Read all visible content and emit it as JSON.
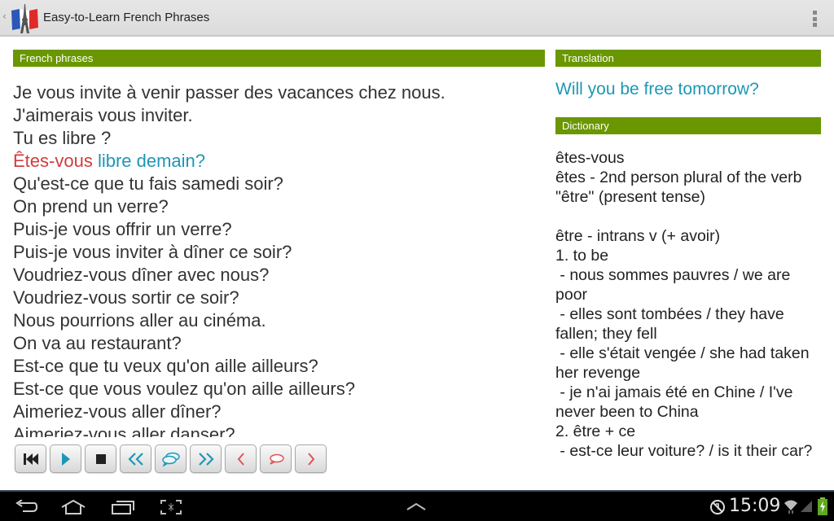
{
  "app": {
    "title": "Easy-to-Learn French Phrases",
    "icon": "eiffel-tower-flag-icon",
    "up_indicator": "‹",
    "overflow_icon": "overflow-menu-icon"
  },
  "left_panel": {
    "header": "French phrases",
    "phrases": [
      "Je vous invite à venir passer des vacances chez nous.",
      "J'aimerais vous inviter.",
      "Tu es libre ?",
      "Êtes-vous libre demain?",
      "Qu'est-ce que tu fais samedi soir?",
      "On prend un verre?",
      "Puis-je vous offrir un verre?",
      "Puis-je vous inviter à dîner ce soir?",
      "Voudriez-vous dîner avec nous?",
      "Voudriez-vous sortir ce soir?",
      "Nous pourrions aller au cinéma.",
      "On va au restaurant?",
      "Est-ce que tu veux qu'on aille ailleurs?",
      "Est-ce que vous voulez qu'on aille ailleurs?",
      "Aimeriez-vous aller dîner?",
      "Aimeriez-vous aller danser?"
    ],
    "selected": {
      "index": 3,
      "highlighted_word": "Êtes-vous",
      "rest": " libre demain?",
      "word_color": "#d23c3c",
      "rest_color": "#1d97b6"
    },
    "controls": [
      {
        "name": "skip-to-start-button",
        "icon": "skip-to-start-icon",
        "color": "#222222"
      },
      {
        "name": "play-button",
        "icon": "play-icon",
        "color": "#1d97b6"
      },
      {
        "name": "stop-button",
        "icon": "stop-icon",
        "color": "#222222"
      },
      {
        "name": "previous-phrase-button",
        "icon": "double-chevron-left-icon",
        "color": "#1d97b6"
      },
      {
        "name": "speak-phrase-button",
        "icon": "speech-bubbles-icon",
        "color": "#1d97b6"
      },
      {
        "name": "next-phrase-button",
        "icon": "double-chevron-right-icon",
        "color": "#1d97b6"
      },
      {
        "name": "previous-word-button",
        "icon": "chevron-left-icon",
        "color": "#e05555"
      },
      {
        "name": "speak-word-button",
        "icon": "speech-bubble-icon",
        "color": "#e05555"
      },
      {
        "name": "next-word-button",
        "icon": "chevron-right-icon",
        "color": "#e05555"
      }
    ]
  },
  "right_panel": {
    "translation_header": "Translation",
    "translation": "Will you be free tomorrow?",
    "dictionary_header": "Dictionary",
    "dictionary_lines": [
      "êtes-vous",
      "êtes - 2nd person plural of the verb \"être\" (present tense)",
      "",
      "être - intrans v (+ avoir)",
      "1. to be",
      " - nous sommes pauvres / we are poor",
      " - elles sont tombées / they have fallen; they fell",
      " - elle s'était vengée / she had taken her revenge",
      " - je n'ai jamais été en Chine / I've never been to China",
      "2. être + ce",
      " - est-ce leur voiture? / is it their car?"
    ]
  },
  "theme": {
    "header_green": "#6a9700",
    "accent_blue": "#1d97b6",
    "accent_red": "#d23c3c"
  },
  "system_bar": {
    "clock": "15:09",
    "nav": [
      "back-icon",
      "home-icon",
      "recent-apps-icon",
      "screenshot-icon"
    ],
    "center": "expand-chevron-up-icon",
    "status": [
      "no-sound-icon",
      "wifi-icon",
      "signal-icon",
      "battery-charging-icon"
    ]
  }
}
